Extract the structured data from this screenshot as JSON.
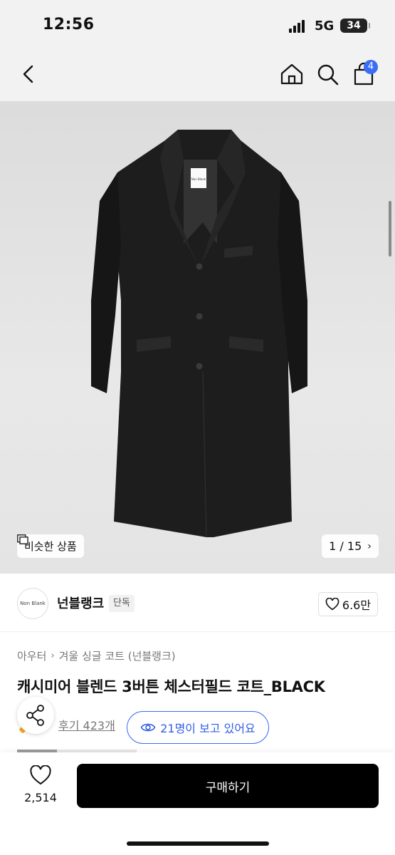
{
  "status_bar": {
    "time": "12:56",
    "network": "5G",
    "battery": "34"
  },
  "nav": {
    "back_icon": "chevron-left-icon",
    "home_icon": "home-icon",
    "search_icon": "search-icon",
    "bag_icon": "shopping-bag-icon",
    "cart_count": "4"
  },
  "hero": {
    "similar_label": "비슷한 상품",
    "counter": "1 / 15",
    "coat_label_text": "Non Blank"
  },
  "brand": {
    "logo_text": "Non Blank",
    "name": "넌블랭크",
    "badge": "단독",
    "likes": "6.6만"
  },
  "product": {
    "breadcrumb": [
      "아우터",
      "겨울 싱글 코트 (넌블랭크)"
    ],
    "title": "캐시미어 블렌드 3버튼 체스터필드 코트_BLACK",
    "review_link": "후기 423개",
    "viewers": "21명이 보고 있어요"
  },
  "bottom_bar": {
    "wish_count": "2,514",
    "buy_label": "구매하기"
  },
  "colors": {
    "accent": "#3b6cf5",
    "buy_button": "#000000",
    "cart_badge": "#3b6cf5"
  }
}
